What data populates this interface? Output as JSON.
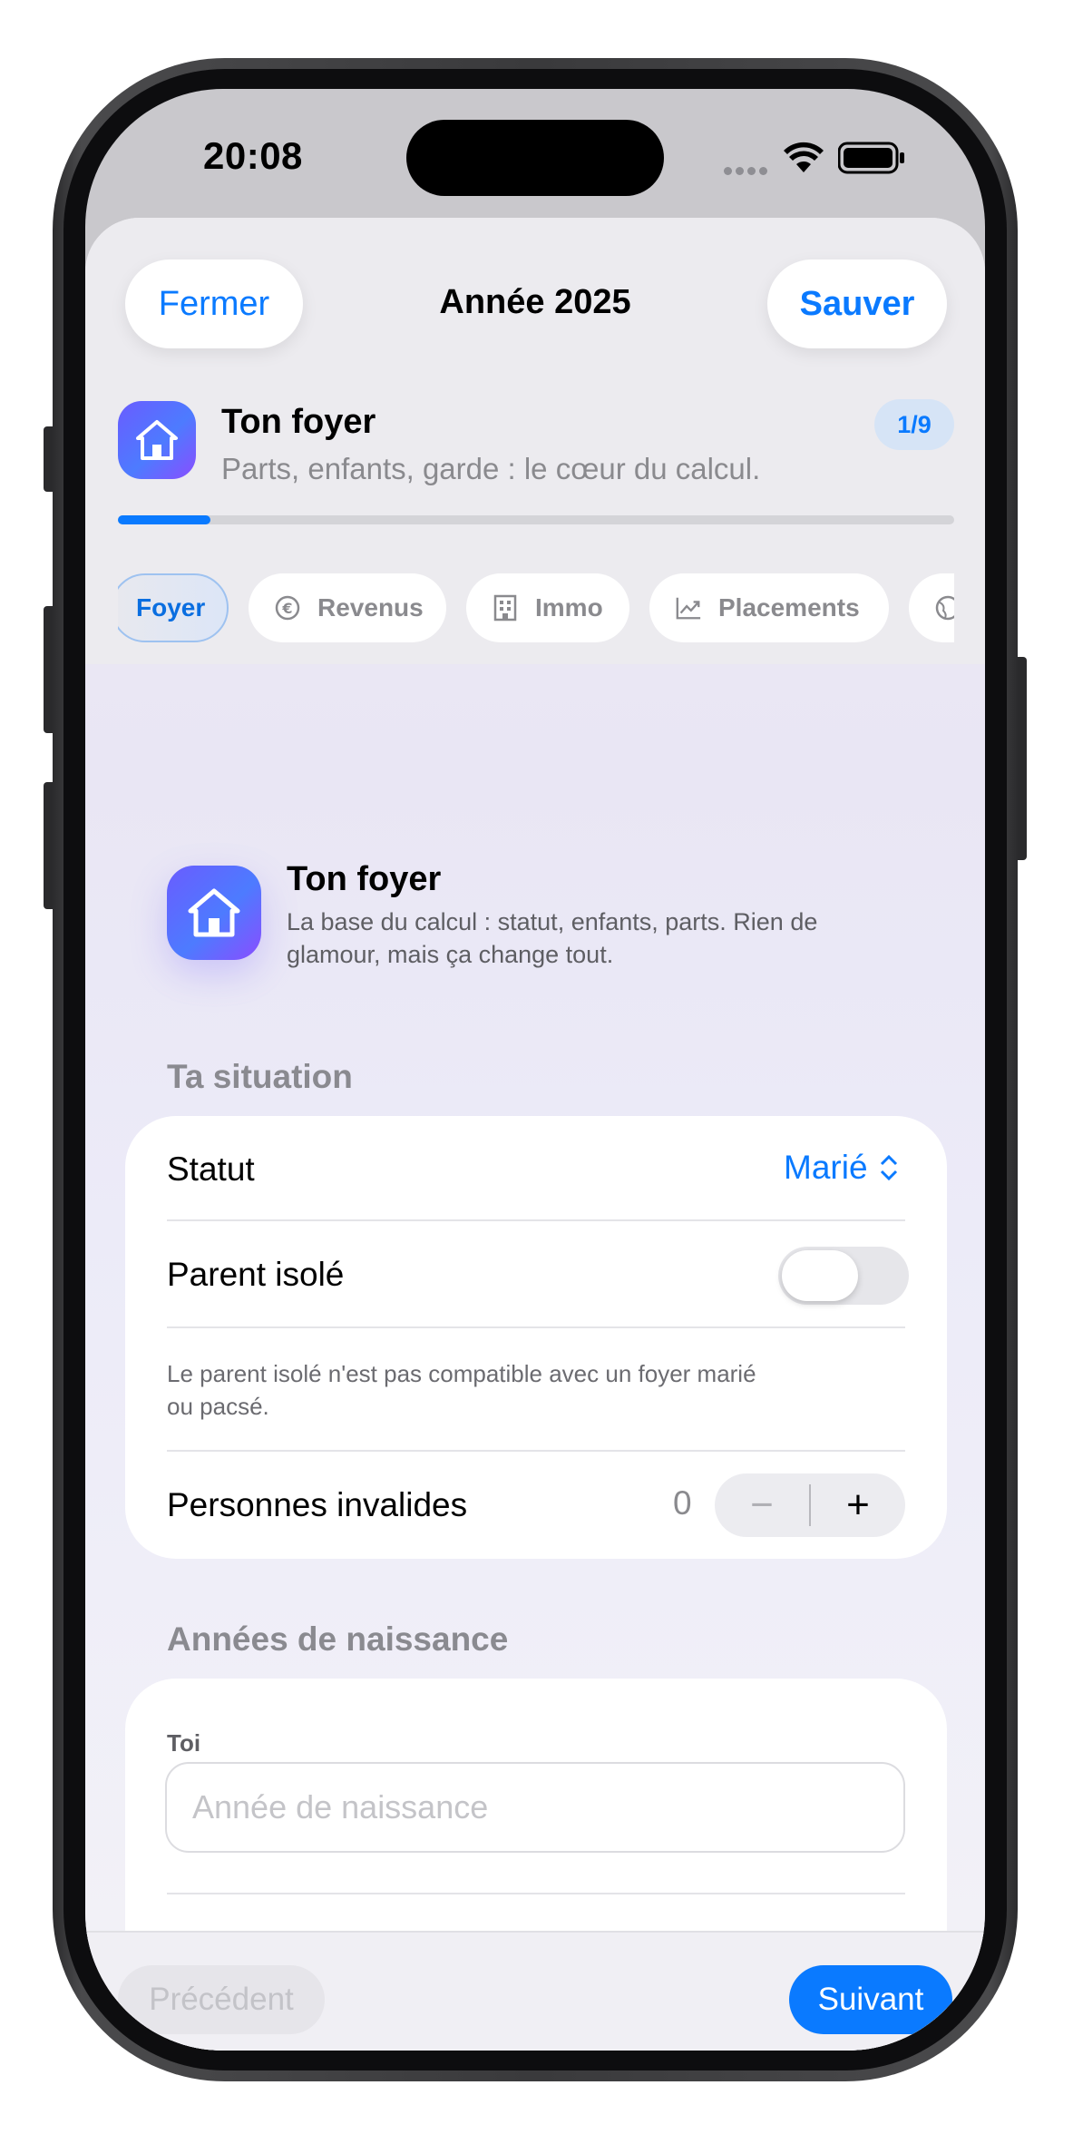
{
  "status_bar": {
    "time": "20:08"
  },
  "nav": {
    "close_label": "Fermer",
    "title": "Année 2025",
    "save_label": "Sauver"
  },
  "step": {
    "title": "Ton foyer",
    "subtitle": "Parts, enfants, garde : le cœur du calcul.",
    "badge": "1/9",
    "progress": 0.111
  },
  "tabs": [
    {
      "label": "Foyer",
      "icon": "house-icon",
      "active": true
    },
    {
      "label": "Revenus",
      "icon": "euro-icon",
      "active": false
    },
    {
      "label": "Immo",
      "icon": "building-icon",
      "active": false
    },
    {
      "label": "Placements",
      "icon": "chart-icon",
      "active": false
    },
    {
      "label": "",
      "icon": "globe-icon",
      "active": false
    }
  ],
  "intro": {
    "title": "Ton foyer",
    "text_line1": "La base du calcul : statut, enfants, parts. Rien de",
    "text_line2": "glamour, mais ça change tout."
  },
  "situation": {
    "section_label": "Ta situation",
    "statut_label": "Statut",
    "statut_value": "Marié",
    "parent_isole_label": "Parent isolé",
    "parent_isole_on": false,
    "note_line1": "Le parent isolé n'est pas compatible avec un foyer marié",
    "note_line2": "ou pacsé.",
    "invalides_label": "Personnes invalides",
    "invalides_value": "0",
    "minus": "−",
    "plus": "+"
  },
  "naissance": {
    "section_label": "Années de naissance",
    "toi_label": "Toi",
    "placeholder": "Année de naissance"
  },
  "footer": {
    "prev_label": "Précédent",
    "next_label": "Suivant"
  },
  "colors": {
    "accent": "#0a7aff"
  }
}
